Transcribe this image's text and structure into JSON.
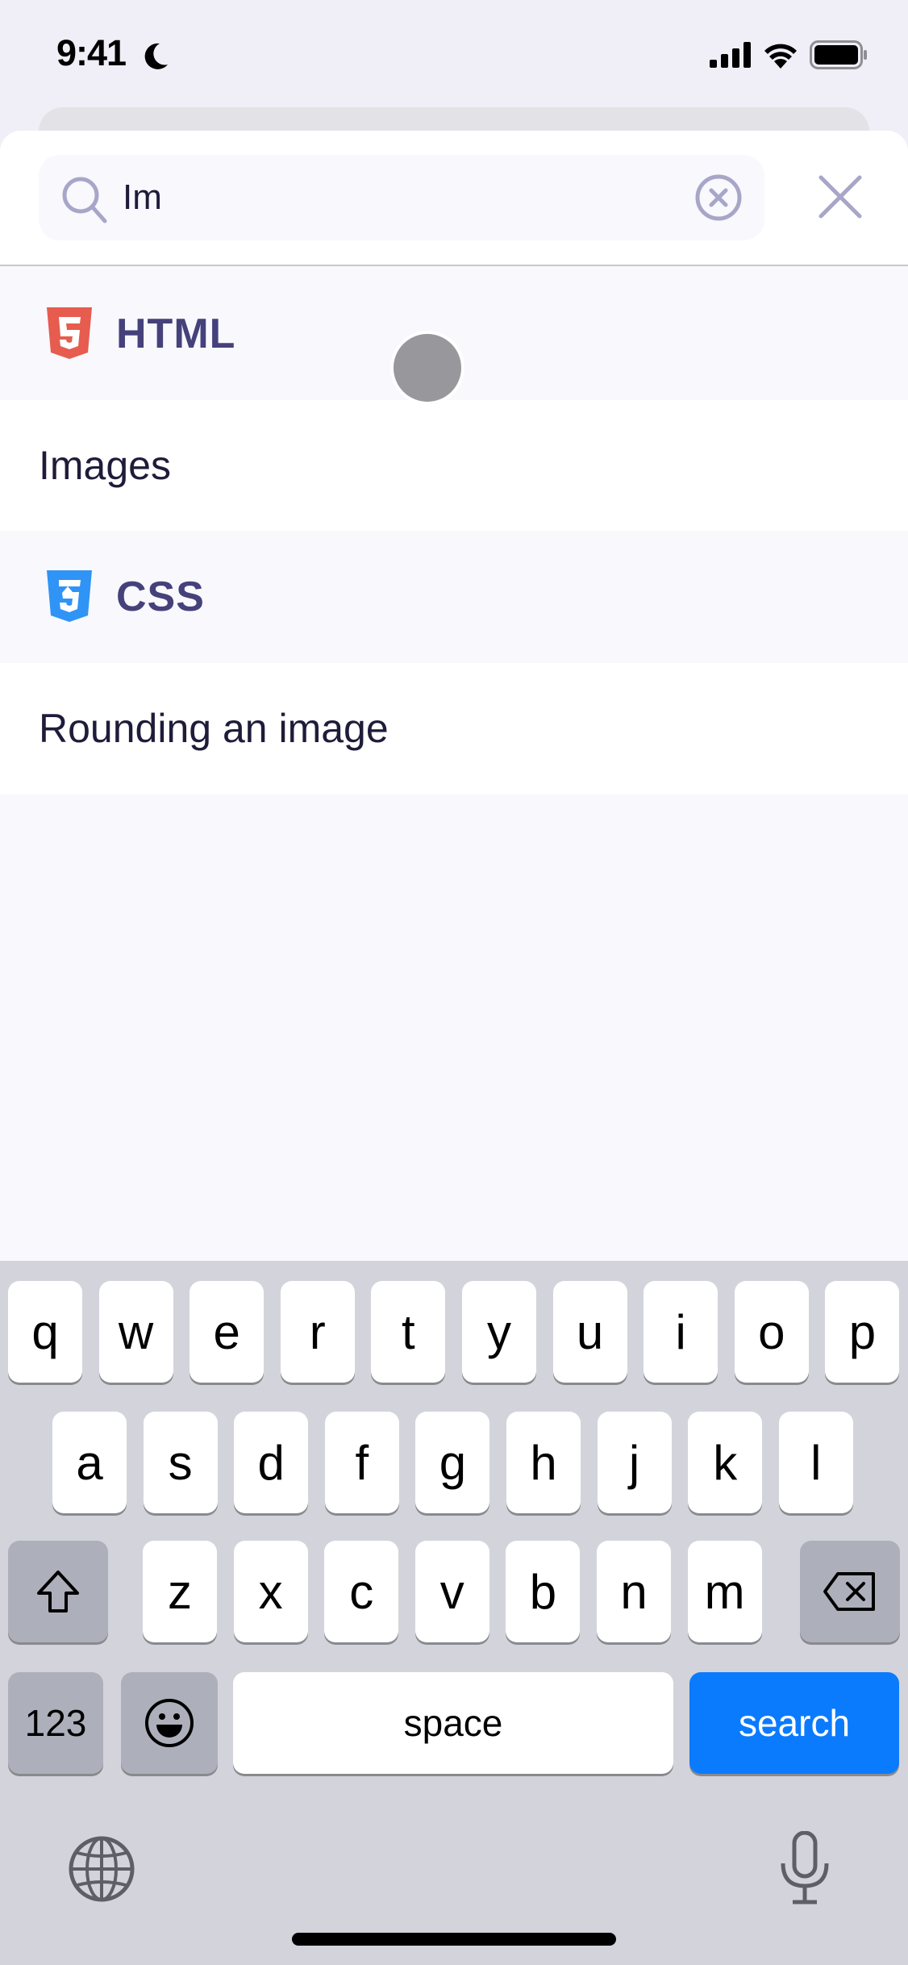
{
  "status_bar": {
    "time": "9:41",
    "focus_icon": "moon-icon",
    "icons": [
      "cellular-signal-icon",
      "wifi-icon",
      "battery-icon"
    ]
  },
  "search": {
    "value": "Im",
    "placeholder": "",
    "search_icon": "search-icon",
    "clear_icon": "clear-circle-icon",
    "close_icon": "close-icon"
  },
  "results": [
    {
      "type": "language",
      "label": "HTML",
      "icon": "html5-icon",
      "color": "#e65c4f"
    },
    {
      "type": "topic",
      "label": "Images"
    },
    {
      "type": "language",
      "label": "CSS",
      "icon": "css3-icon",
      "color": "#2f94f5"
    },
    {
      "type": "topic",
      "label": "Rounding an image"
    }
  ],
  "keyboard": {
    "row1": [
      "q",
      "w",
      "e",
      "r",
      "t",
      "y",
      "u",
      "i",
      "o",
      "p"
    ],
    "row2": [
      "a",
      "s",
      "d",
      "f",
      "g",
      "h",
      "j",
      "k",
      "l"
    ],
    "row3": [
      "z",
      "x",
      "c",
      "v",
      "b",
      "n",
      "m"
    ],
    "shift_icon": "shift-icon",
    "delete_icon": "delete-icon",
    "numbers_label": "123",
    "emoji_icon": "emoji-icon",
    "space_label": "space",
    "action_label": "search",
    "globe_icon": "globe-icon",
    "mic_icon": "microphone-icon",
    "action_color": "#0b7bfe"
  },
  "colors": {
    "accent_text": "#45417a",
    "icon_tint": "#a8a6c8"
  }
}
